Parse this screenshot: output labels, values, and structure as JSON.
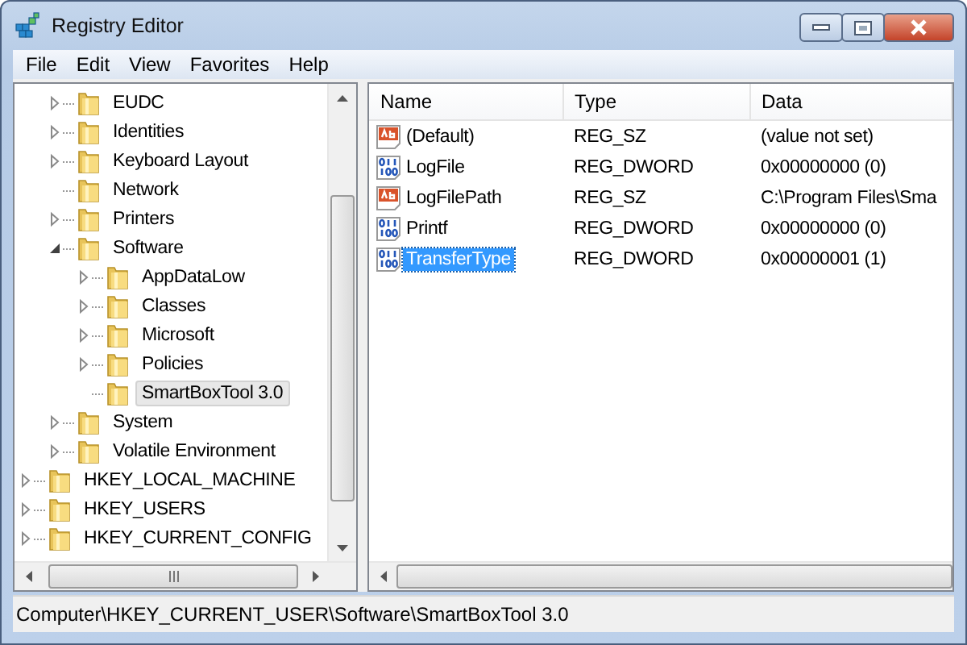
{
  "window": {
    "title": "Registry Editor"
  },
  "menu": [
    "File",
    "Edit",
    "View",
    "Favorites",
    "Help"
  ],
  "tree_partial": [
    {
      "label": "EUDC",
      "expanded": false,
      "selected": false
    },
    {
      "label": "Identities",
      "expanded": false,
      "selected": false
    },
    {
      "label": "Keyboard Layout",
      "expanded": false,
      "selected": false
    },
    {
      "label": "Network",
      "selected": false
    },
    {
      "label": "Printers",
      "expanded": false,
      "selected": false
    },
    {
      "label": "Software",
      "expanded": true,
      "selected": false,
      "children": [
        {
          "label": "AppDataLow",
          "expanded": false,
          "selected": false
        },
        {
          "label": "Classes",
          "expanded": false,
          "selected": false
        },
        {
          "label": "Microsoft",
          "expanded": false,
          "selected": false
        },
        {
          "label": "Policies",
          "expanded": false,
          "selected": false
        },
        {
          "label": "SmartBoxTool 3.0",
          "selected": true
        }
      ]
    },
    {
      "label": "System",
      "expanded": false,
      "selected": false
    },
    {
      "label": "Volatile Environment",
      "expanded": false,
      "selected": false
    }
  ],
  "tree_roots": [
    {
      "label": "HKEY_LOCAL_MACHINE",
      "expanded": false,
      "selected": false
    },
    {
      "label": "HKEY_USERS",
      "expanded": false,
      "selected": false
    },
    {
      "label": "HKEY_CURRENT_CONFIG",
      "expanded": false,
      "selected": false
    }
  ],
  "table": {
    "columns": [
      "Name",
      "Type",
      "Data"
    ],
    "rows": [
      {
        "kind": "string",
        "name": "(Default)",
        "type": "REG_SZ",
        "data": "(value not set)",
        "selected": false
      },
      {
        "kind": "dword",
        "name": "LogFile",
        "type": "REG_DWORD",
        "data": "0x00000000 (0)",
        "selected": false
      },
      {
        "kind": "string",
        "name": "LogFilePath",
        "type": "REG_SZ",
        "data": "C:\\Program Files\\Sma",
        "selected": false
      },
      {
        "kind": "dword",
        "name": "Printf",
        "type": "REG_DWORD",
        "data": "0x00000000 (0)",
        "selected": false
      },
      {
        "kind": "dword",
        "name": "TransferType",
        "type": "REG_DWORD",
        "data": "0x00000001 (1)",
        "selected": true
      }
    ]
  },
  "status_bar": "Computer\\HKEY_CURRENT_USER\\Software\\SmartBoxTool 3.0"
}
